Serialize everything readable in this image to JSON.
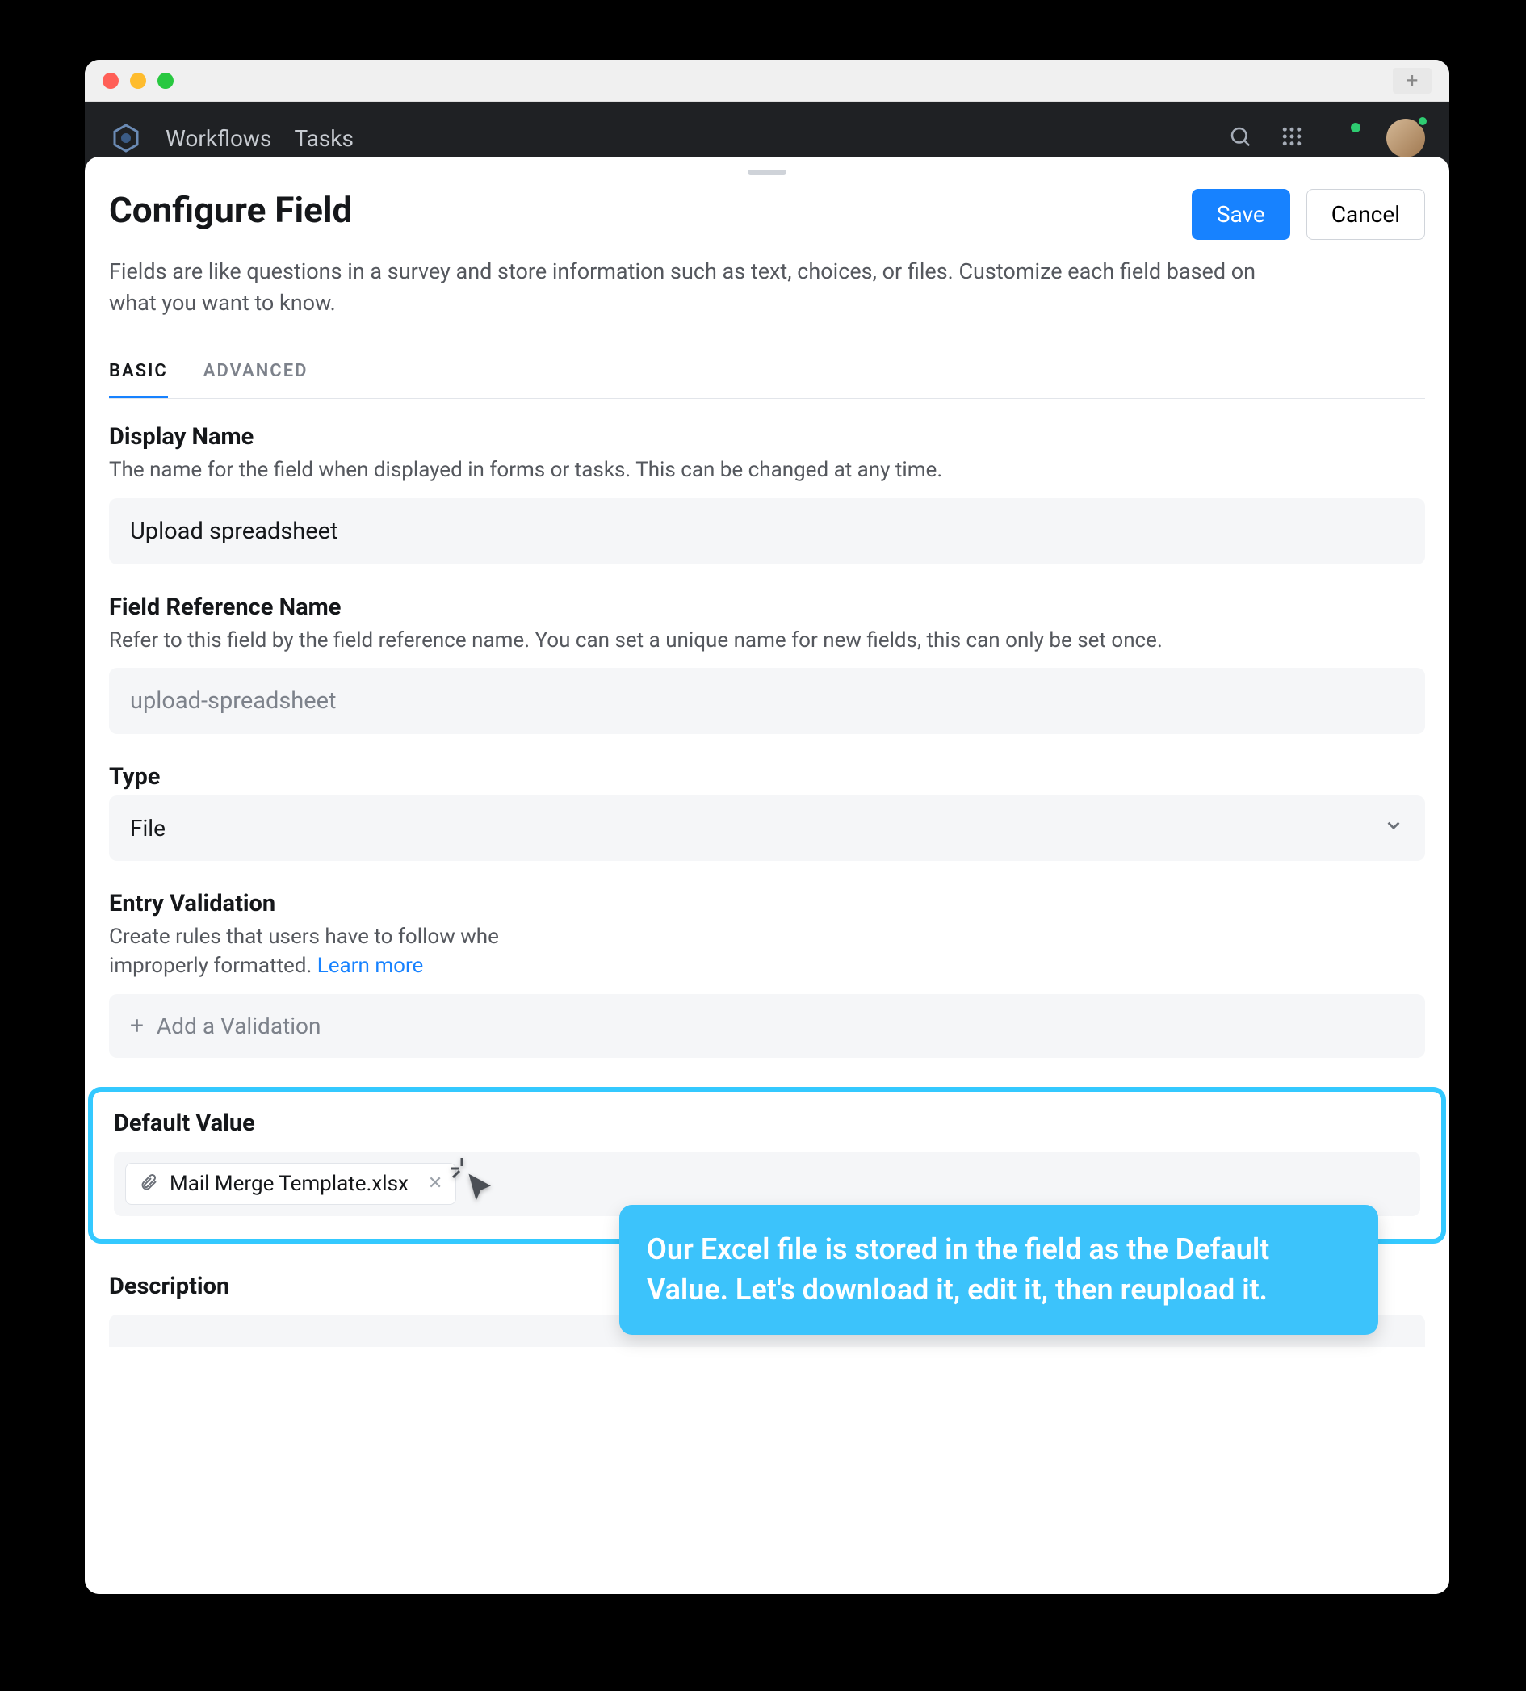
{
  "nav": {
    "workflows": "Workflows",
    "tasks": "Tasks"
  },
  "modal": {
    "title": "Configure Field",
    "save": "Save",
    "cancel": "Cancel",
    "subtitle": "Fields are like questions in a survey and store information such as text, choices, or files. Customize each field based on what you want to know."
  },
  "tabs": {
    "basic": "BASIC",
    "advanced": "ADVANCED"
  },
  "display_name": {
    "label": "Display Name",
    "desc": "The name for the field when displayed in forms or tasks. This can be changed at any time.",
    "value": "Upload spreadsheet"
  },
  "ref_name": {
    "label": "Field Reference Name",
    "desc": "Refer to this field by the field reference name. You can set a unique name for new fields, this can only be set once.",
    "value": "upload-spreadsheet"
  },
  "type": {
    "label": "Type",
    "value": "File"
  },
  "validation": {
    "label": "Entry Validation",
    "desc_a": "Create rules that users have to follow whe",
    "desc_b": "improperly formatted. ",
    "learn": "Learn more",
    "add": "Add a Validation"
  },
  "default_value": {
    "label": "Default Value",
    "file_name": "Mail Merge Template.xlsx"
  },
  "description": {
    "label": "Description"
  },
  "callout": "Our Excel file is stored in the field as the Default Value. Let's download it, edit it, then reupload it."
}
